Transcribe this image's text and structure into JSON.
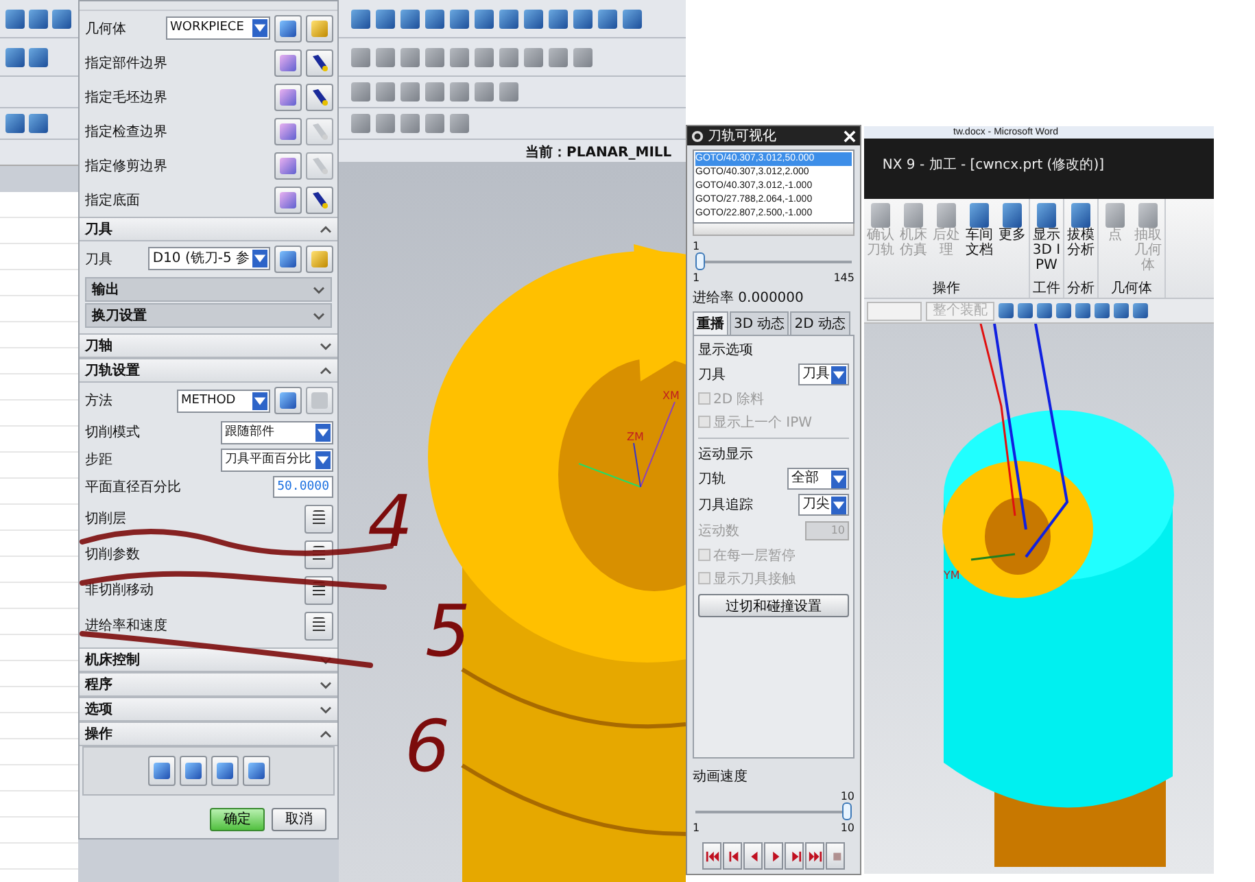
{
  "cad_toolbar": {
    "current_label": "当前：PLANAR_MILL"
  },
  "operation_dialog": {
    "geometry": {
      "label": "几何体",
      "value": "WORKPIECE"
    },
    "boundaries": [
      {
        "label": "指定部件边界",
        "display_enabled": true
      },
      {
        "label": "指定毛坯边界",
        "display_enabled": true
      },
      {
        "label": "指定检查边界",
        "display_enabled": false
      },
      {
        "label": "指定修剪边界",
        "display_enabled": false
      },
      {
        "label": "指定底面",
        "display_enabled": true
      }
    ],
    "tool_section": {
      "title": "刀具",
      "expanded": true,
      "label": "刀具",
      "value": "D10 (铣刀-5 参",
      "subsections": [
        {
          "title": "输出",
          "expanded": false
        },
        {
          "title": "换刀设置",
          "expanded": false
        }
      ]
    },
    "axis_section": {
      "title": "刀轴",
      "expanded": false
    },
    "path_section": {
      "title": "刀轨设置",
      "expanded": true,
      "rows": [
        {
          "kind": "dropdown-edit",
          "label": "方法",
          "value": "METHOD"
        },
        {
          "kind": "dropdown",
          "label": "切削模式",
          "value": "跟随部件"
        },
        {
          "kind": "dropdown",
          "label": "步距",
          "value": "刀具平面百分比"
        },
        {
          "kind": "number",
          "label": "平面直径百分比",
          "value": "50.0000"
        },
        {
          "kind": "button",
          "label": "切削层"
        },
        {
          "kind": "button",
          "label": "切削参数"
        },
        {
          "kind": "button",
          "label": "非切削移动"
        },
        {
          "kind": "button",
          "label": "进给率和速度"
        }
      ]
    },
    "more_sections": [
      {
        "title": "机床控制",
        "expanded": false
      },
      {
        "title": "程序",
        "expanded": false
      },
      {
        "title": "选项",
        "expanded": false
      },
      {
        "title": "操作",
        "expanded": true
      }
    ],
    "buttons": [
      {
        "label": "确定",
        "primary": true
      },
      {
        "label": "取消",
        "primary": false
      }
    ]
  },
  "viewport": {
    "axis_labels": [
      "XM",
      "ZM"
    ]
  },
  "annotations": [
    "4",
    "5",
    "6"
  ],
  "visualization_dialog": {
    "title": "刀轨可视化",
    "path_lines": [
      {
        "text": "GOTO/40.307,3.012,50.000",
        "selected": true
      },
      {
        "text": "GOTO/40.307,3.012,2.000",
        "selected": false
      },
      {
        "text": "GOTO/40.307,3.012,-1.000",
        "selected": false
      },
      {
        "text": "GOTO/27.788,2.064,-1.000",
        "selected": false
      },
      {
        "text": "GOTO/22.807,2.500,-1.000",
        "selected": false
      }
    ],
    "step_slider": {
      "value": "1",
      "min": "1",
      "max": "145",
      "level": 0
    },
    "feed_rate": "进给率 0.000000",
    "tabs": [
      {
        "label": "重播",
        "selected": true
      },
      {
        "label": "3D 动态",
        "selected": false
      },
      {
        "label": "2D 动态",
        "selected": false
      }
    ],
    "display_options": {
      "title": "显示选项",
      "tool_label": "刀具",
      "tool_value": "刀具",
      "checks": [
        {
          "label": "2D 除料",
          "checked": false,
          "disabled": true
        },
        {
          "label": "显示上一个 IPW",
          "checked": false,
          "disabled": true
        }
      ]
    },
    "motion_display": {
      "title": "运动显示",
      "rows": [
        {
          "kind": "dropdown",
          "label": "刀轨",
          "value": "全部",
          "disabled": false
        },
        {
          "kind": "dropdown",
          "label": "刀具追踪",
          "value": "刀尖",
          "disabled": false
        },
        {
          "kind": "number",
          "label": "运动数",
          "value": "10",
          "disabled": true
        }
      ],
      "checks": [
        {
          "label": "在每一层暂停",
          "checked": false,
          "disabled": true
        },
        {
          "label": "显示刀具接触",
          "checked": false,
          "disabled": true
        }
      ],
      "button": "过切和碰撞设置"
    },
    "speed": {
      "title": "动画速度",
      "value": "10",
      "min": "1",
      "max": "10",
      "level": 1
    },
    "playback_buttons": [
      {
        "kind": "to-start",
        "disabled": false
      },
      {
        "kind": "step-back",
        "disabled": false
      },
      {
        "kind": "reverse",
        "disabled": false
      },
      {
        "kind": "play",
        "disabled": false
      },
      {
        "kind": "step-forward",
        "disabled": false
      },
      {
        "kind": "to-end",
        "disabled": false
      },
      {
        "kind": "stop",
        "disabled": true
      }
    ]
  },
  "nx_window": {
    "word_title": "tw.docx - Microsoft Word",
    "title": "NX 9 - 加工 - [cwncx.prt (修改的)]",
    "ribbon_groups": [
      {
        "title": "操作",
        "items": [
          {
            "label": "确认刀轨",
            "disabled": true
          },
          {
            "label": "机床仿真",
            "disabled": true
          },
          {
            "label": "后处理",
            "disabled": true
          },
          {
            "label": "车间文档",
            "disabled": false
          },
          {
            "label": "更多",
            "disabled": false
          }
        ]
      },
      {
        "title": "工件",
        "items": [
          {
            "label": "显示 3D IPW",
            "disabled": false
          }
        ]
      },
      {
        "title": "分析",
        "items": [
          {
            "label": "拔模分析",
            "disabled": false
          }
        ]
      },
      {
        "title": "几何体",
        "items": [
          {
            "label": "点",
            "disabled": true
          },
          {
            "label": "抽取几何体",
            "disabled": true
          }
        ]
      }
    ],
    "filter_value": "整个装配",
    "axis_label": "YM"
  }
}
